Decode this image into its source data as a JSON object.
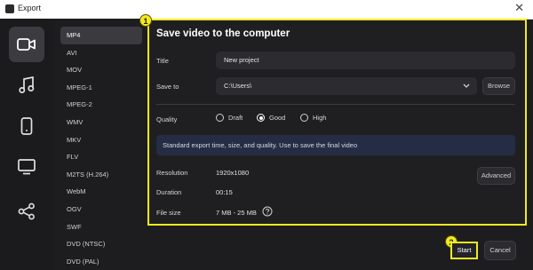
{
  "window": {
    "title": "Export",
    "close_glyph": "✕"
  },
  "iconbar": [
    {
      "name": "video",
      "icon": "video-camera-icon",
      "active": true
    },
    {
      "name": "audio",
      "icon": "music-note-icon",
      "active": false
    },
    {
      "name": "device",
      "icon": "phone-icon",
      "active": false
    },
    {
      "name": "tv",
      "icon": "monitor-icon",
      "active": false
    },
    {
      "name": "share",
      "icon": "share-icon",
      "active": false
    }
  ],
  "formats": [
    "MP4",
    "AVI",
    "MOV",
    "MPEG-1",
    "MPEG-2",
    "WMV",
    "MKV",
    "FLV",
    "M2TS (H.264)",
    "WebM",
    "OGV",
    "SWF",
    "DVD (NTSC)",
    "DVD (PAL)"
  ],
  "selected_format": "MP4",
  "panel": {
    "heading": "Save video to the computer",
    "title_label": "Title",
    "title_value": "New project",
    "saveto_label": "Save to",
    "saveto_value": "C:\\Users\\",
    "browse_label": "Browse",
    "quality_label": "Quality",
    "quality_options": [
      "Draft",
      "Good",
      "High"
    ],
    "quality_selected": "Good",
    "info_text": "Standard export time, size, and quality. Use to save the final video",
    "resolution_label": "Resolution",
    "resolution_value": "1920x1080",
    "advanced_label": "Advanced",
    "duration_label": "Duration",
    "duration_value": "00:15",
    "filesize_label": "File size",
    "filesize_value": "7 MB - 25 MB"
  },
  "badges": {
    "one": "1",
    "two": "2"
  },
  "footer": {
    "start_label": "Start",
    "cancel_label": "Cancel"
  },
  "colors": {
    "highlight": "#f2ea1c",
    "background": "#1d1d20",
    "info_bg": "#252d44"
  }
}
